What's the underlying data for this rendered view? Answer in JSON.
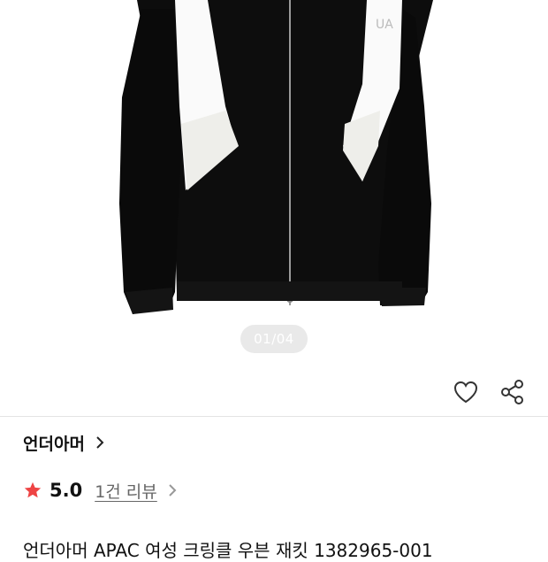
{
  "image_pager": {
    "counter": "01/04"
  },
  "brand": {
    "name": "언더아머"
  },
  "rating": {
    "score": "5.0",
    "review_count_label": "1건 리뷰"
  },
  "product": {
    "title": "언더아머 APAC 여성 크링클 우븐 재킷 1382965-001"
  },
  "colors": {
    "star": "#ee4444",
    "pager_bg": "#e9e9e9",
    "divider": "#e3e3e3"
  },
  "icons": [
    "heart-icon",
    "share-icon",
    "chevron-right-icon",
    "star-icon"
  ]
}
